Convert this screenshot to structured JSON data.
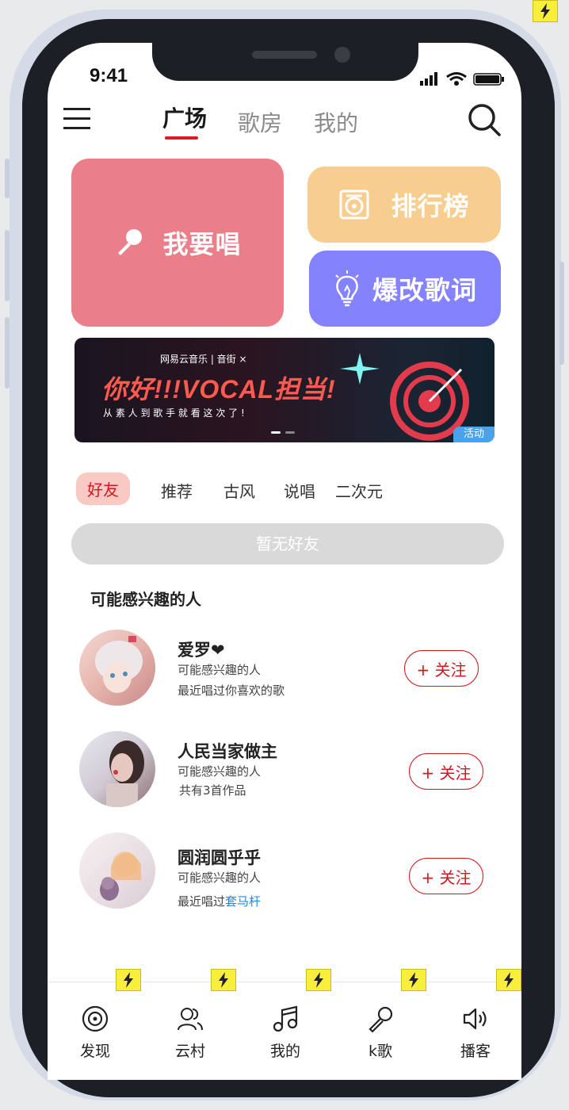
{
  "status_bar": {
    "time": "9:41"
  },
  "top_tabs": [
    "广场",
    "歌房",
    "我的"
  ],
  "tiles": {
    "sing": "我要唱",
    "ranking": "排行榜",
    "lyrics": "爆改歌词"
  },
  "banner": {
    "brand": "网易云音乐 | 音街 ×",
    "headline": "你好!!!VOCAL担当!",
    "sub": "从 素 人 到 歌 手   就 看 这 次 了 !",
    "tag": "活动"
  },
  "categories": [
    "好友",
    "推荐",
    "古风",
    "说唱",
    "二次元"
  ],
  "empty_friends": "暂无好友",
  "section_title": "可能感兴趣的人",
  "people": [
    {
      "name": "爱罗❤",
      "line1": "可能感兴趣的人",
      "line2": "最近唱过你喜欢的歌",
      "follow": "+ 关注"
    },
    {
      "name": "人民当家做主",
      "line1": "可能感兴趣的人",
      "line2": "共有3首作品",
      "follow": "+ 关注"
    },
    {
      "name": "圆润圆乎乎",
      "line1": "可能感兴趣的人",
      "line2_prefix": "最近唱过",
      "line2_link": "套马杆",
      "follow": "+ 关注"
    }
  ],
  "bottom_nav": [
    "发现",
    "云村",
    "我的",
    "k歌",
    "播客"
  ],
  "colors": {
    "accent": "#d2181f",
    "sing_tile": "#ea7f8a",
    "ranking_tile": "#f8ce90",
    "lyrics_tile": "#8482fc",
    "link": "#1e88e5"
  }
}
